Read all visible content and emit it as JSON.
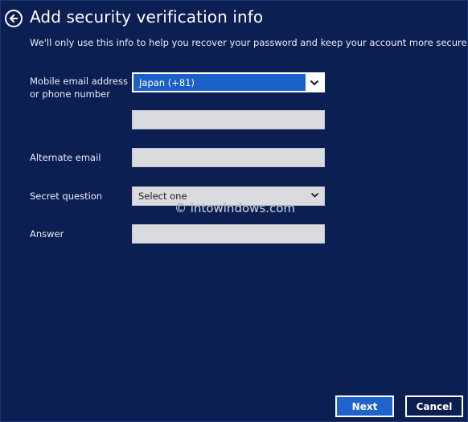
{
  "header": {
    "title": "Add security verification info",
    "subtitle": "We'll only use this info to help you recover your password and keep your account more secure."
  },
  "form": {
    "mobile_label_line1": "Mobile email address",
    "mobile_label_line2": "or phone number",
    "country_value": "Japan (+81)",
    "phone_value": "",
    "alternate_email_label": "Alternate email",
    "alternate_email_value": "",
    "secret_question_label": "Secret question",
    "secret_question_value": "Select one",
    "answer_label": "Answer",
    "answer_value": ""
  },
  "watermark": "© intowindows.com",
  "buttons": {
    "next": "Next",
    "cancel": "Cancel"
  },
  "icons": {
    "back": "back-arrow-icon",
    "dropdown": "chevron-down-icon"
  },
  "colors": {
    "background": "#0c1f52",
    "accent": "#1f63cc",
    "field": "#dadbde"
  }
}
